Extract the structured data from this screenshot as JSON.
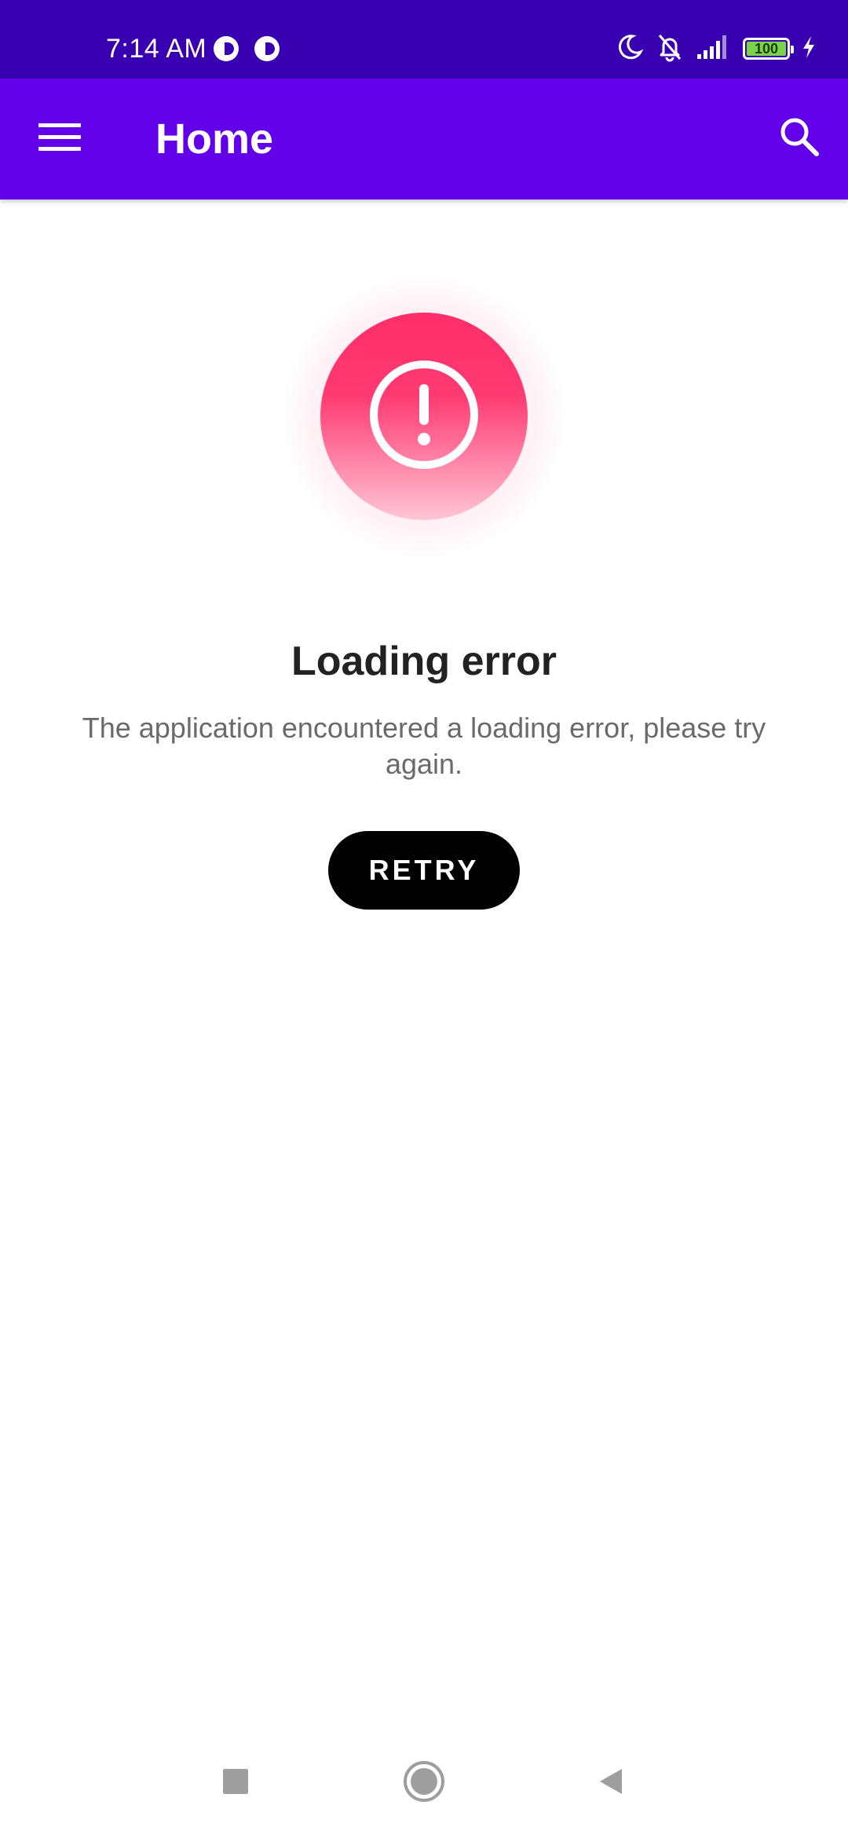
{
  "status_bar": {
    "time": "7:14 AM",
    "battery_level": "100",
    "icons": [
      "app-notification-icon",
      "app-notification-icon",
      "moon-icon",
      "bell-off-icon",
      "signal-icon",
      "battery-icon",
      "charging-icon"
    ],
    "battery_color": "#7bd34a"
  },
  "app_bar": {
    "title": "Home",
    "menu_icon": "hamburger-menu-icon",
    "search_icon": "search-icon",
    "color": "#6200ea"
  },
  "error": {
    "icon": "exclamation-circle-icon",
    "title": "Loading error",
    "message": "The application encountered a loading error, please try again.",
    "retry_label": "RETRY",
    "accent_color": "#ff2d6a"
  },
  "nav_bar": {
    "recents_icon": "square-recents-icon",
    "home_icon": "circle-home-icon",
    "back_icon": "triangle-back-icon"
  }
}
